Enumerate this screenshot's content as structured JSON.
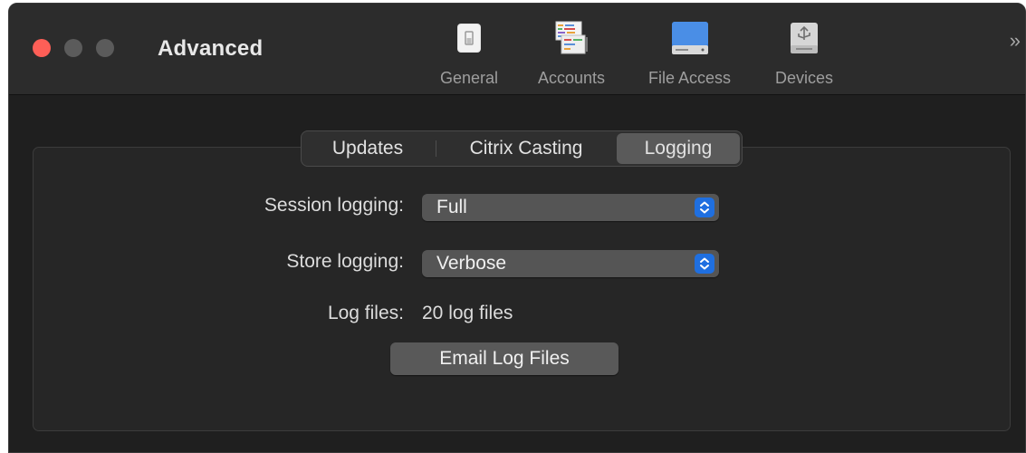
{
  "window": {
    "title": "Advanced"
  },
  "toolbar": {
    "items": [
      {
        "label": "General",
        "icon": "general-switch-icon"
      },
      {
        "label": "Accounts",
        "icon": "accounts-list-icon"
      },
      {
        "label": "File Access",
        "icon": "file-access-drive-icon"
      },
      {
        "label": "Devices",
        "icon": "usb-devices-icon"
      }
    ],
    "overflow": "»"
  },
  "tabs": [
    {
      "label": "Updates",
      "selected": false
    },
    {
      "label": "Citrix Casting",
      "selected": false
    },
    {
      "label": "Logging",
      "selected": true
    }
  ],
  "form": {
    "session_logging": {
      "label": "Session logging:",
      "value": "Full"
    },
    "store_logging": {
      "label": "Store logging:",
      "value": "Verbose"
    },
    "log_files": {
      "label": "Log files:",
      "value": "20 log files"
    },
    "email_button": "Email Log Files"
  },
  "colors": {
    "close": "#fe5f57",
    "accent": "#1f6fe0"
  }
}
